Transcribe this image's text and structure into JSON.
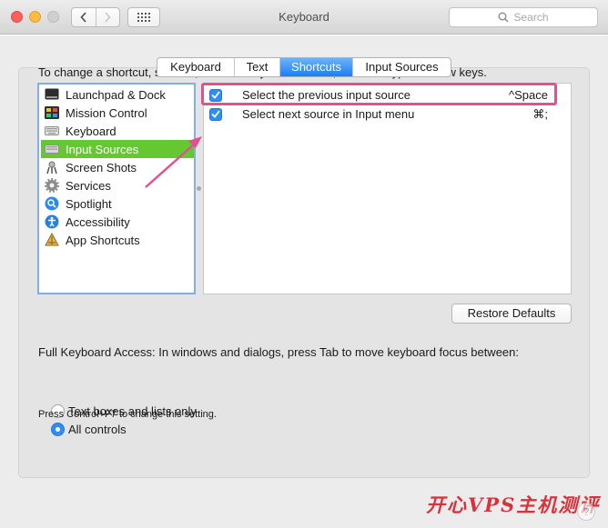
{
  "window": {
    "title": "Keyboard"
  },
  "toolbar": {
    "search_placeholder": "Search"
  },
  "tabs": [
    {
      "label": "Keyboard",
      "selected": false
    },
    {
      "label": "Text",
      "selected": false
    },
    {
      "label": "Shortcuts",
      "selected": true
    },
    {
      "label": "Input Sources",
      "selected": false
    }
  ],
  "instructions": "To change a shortcut, select it, click the key combination, and then type the new keys.",
  "categories": [
    {
      "label": "Launchpad & Dock",
      "icon": "launchpad-dock-icon"
    },
    {
      "label": "Mission Control",
      "icon": "mission-control-icon"
    },
    {
      "label": "Keyboard",
      "icon": "keyboard-icon"
    },
    {
      "label": "Input Sources",
      "icon": "input-sources-icon",
      "selected": true
    },
    {
      "label": "Screen Shots",
      "icon": "screen-shots-icon"
    },
    {
      "label": "Services",
      "icon": "gear-icon"
    },
    {
      "label": "Spotlight",
      "icon": "spotlight-icon"
    },
    {
      "label": "Accessibility",
      "icon": "accessibility-icon"
    },
    {
      "label": "App Shortcuts",
      "icon": "app-shortcuts-icon"
    }
  ],
  "shortcuts": [
    {
      "label": "Select the previous input source",
      "key": "^Space",
      "checked": true
    },
    {
      "label": "Select next source in Input menu",
      "key": "⌘;",
      "checked": true
    }
  ],
  "restore_button": "Restore Defaults",
  "full_keyboard_access": {
    "label": "Full Keyboard Access: In windows and dialogs, press Tab to move keyboard focus between:",
    "options": [
      {
        "label": "Text boxes and lists only",
        "selected": false
      },
      {
        "label": "All controls",
        "selected": true
      }
    ],
    "hint": "Press Control+F7 to change this setting."
  },
  "watermark": "开心VPS主机测评",
  "help_button": "?",
  "colors": {
    "accent": "#2e8ef5",
    "selection": "#65c732",
    "annotation": "#e2508f"
  }
}
